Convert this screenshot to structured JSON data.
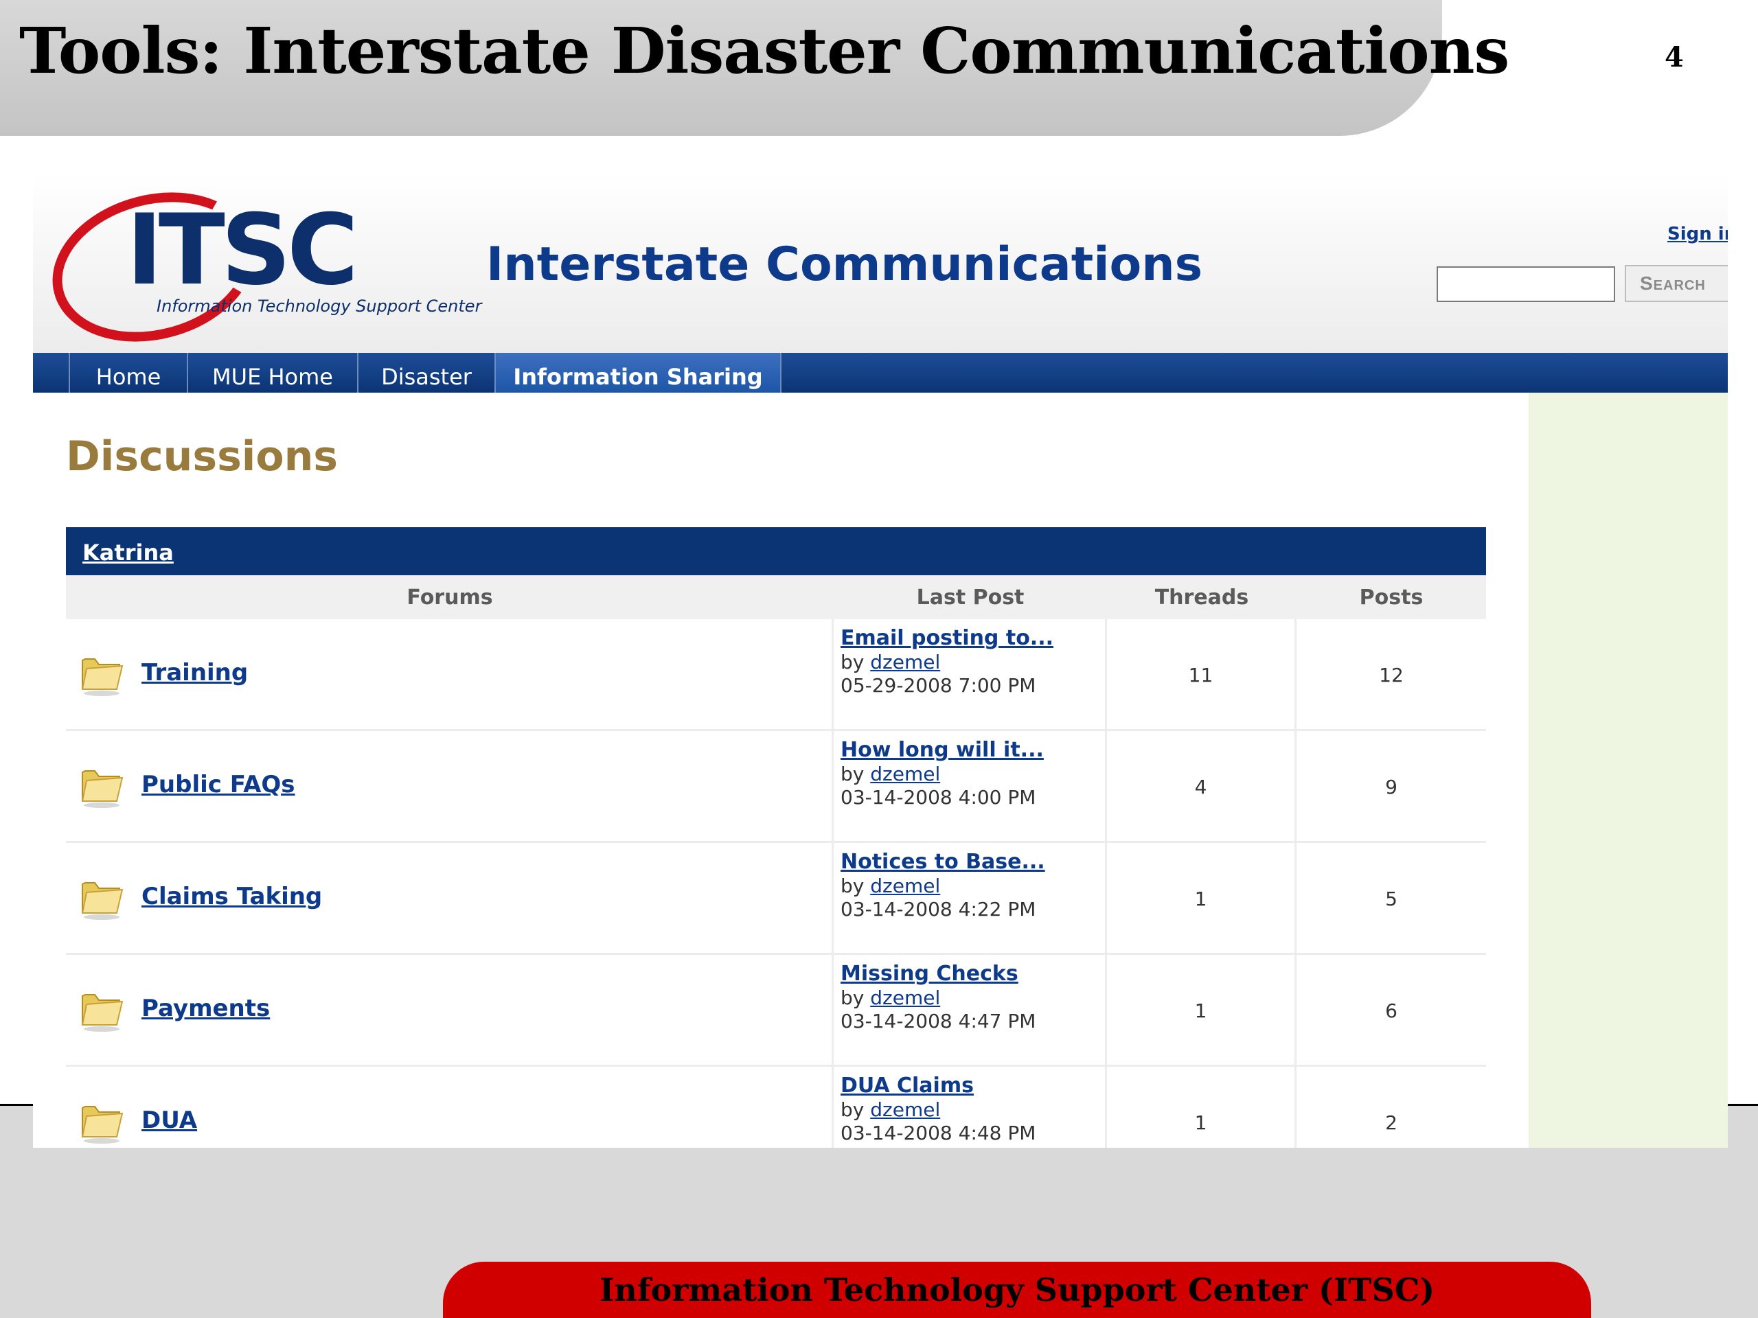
{
  "slide": {
    "title": "Tools:  Interstate Disaster Communications",
    "page_number": "4",
    "footer": "Information Technology Support Center (ITSC)"
  },
  "site": {
    "logo_text": "ITSC",
    "logo_subtitle": "Information Technology Support Center",
    "title": "Interstate Communications",
    "signin_label": "Sign in",
    "search_button": "Search",
    "search_value": ""
  },
  "colors": {
    "nav_blue": "#0b3475",
    "link_blue": "#0d3a8a",
    "logo_red": "#d1121c",
    "heading_gold": "#9a7b3e",
    "sidebar_green": "#eef5e1",
    "footer_red": "#d00000"
  },
  "nav": {
    "tabs": [
      {
        "label": "Home"
      },
      {
        "label": "MUE Home"
      },
      {
        "label": "Disaster"
      },
      {
        "label": "Information Sharing",
        "active": true
      }
    ]
  },
  "discussions": {
    "heading": "Discussions",
    "group_name": "Katrina",
    "columns": {
      "forums": "Forums",
      "last_post": "Last Post",
      "threads": "Threads",
      "posts": "Posts"
    },
    "rows": [
      {
        "forum": "Training",
        "last_title": "Email posting to...",
        "by": "by",
        "author": "dzemel",
        "date": "05-29-2008 7:00 PM",
        "threads": "11",
        "posts": "12",
        "icon": "folder-icon"
      },
      {
        "forum": "Public FAQs",
        "last_title": "How long will it...",
        "by": "by",
        "author": "dzemel",
        "date": "03-14-2008 4:00 PM",
        "threads": "4",
        "posts": "9",
        "icon": "folder-icon"
      },
      {
        "forum": "Claims Taking",
        "last_title": "Notices to Base...",
        "by": "by",
        "author": "dzemel",
        "date": "03-14-2008 4:22 PM",
        "threads": "1",
        "posts": "5",
        "icon": "folder-icon"
      },
      {
        "forum": "Payments",
        "last_title": "Missing Checks",
        "by": "by",
        "author": "dzemel",
        "date": "03-14-2008 4:47 PM",
        "threads": "1",
        "posts": "6",
        "icon": "folder-icon"
      },
      {
        "forum": "DUA",
        "last_title": "DUA Claims",
        "by": "by",
        "author": "dzemel",
        "date": "03-14-2008 4:48 PM",
        "threads": "1",
        "posts": "2",
        "icon": "folder-icon"
      }
    ]
  }
}
